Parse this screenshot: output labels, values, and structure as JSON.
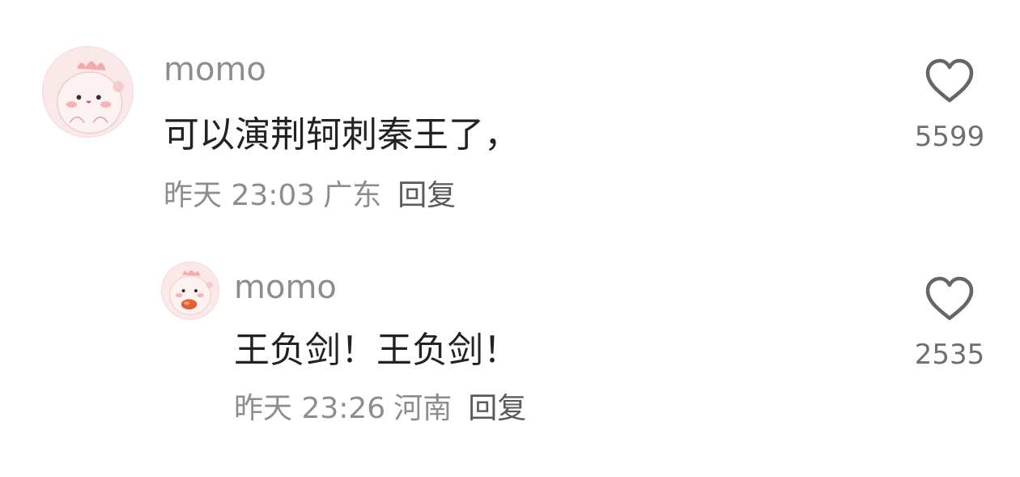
{
  "comments": [
    {
      "username": "momo",
      "text": "可以演荆轲刺秦王了，",
      "time": "昨天 23:03",
      "location": "广东",
      "reply_label": "回复",
      "likes": "5599",
      "avatar_icon": "pink-cartoon-avatar-icon"
    },
    {
      "username": "momo",
      "text": "王负剑！王负剑！",
      "time": "昨天 23:26",
      "location": "河南",
      "reply_label": "回复",
      "likes": "2535",
      "avatar_icon": "pink-cartoon-eating-avatar-icon"
    }
  ],
  "colors": {
    "username": "#8d8d8d",
    "text": "#222222",
    "meta": "#8d8d8d",
    "reply": "#5a5a5a",
    "like_count": "#6f6f6f",
    "heart_outline": "#666666",
    "avatar_bg": "#fbe9ea"
  }
}
